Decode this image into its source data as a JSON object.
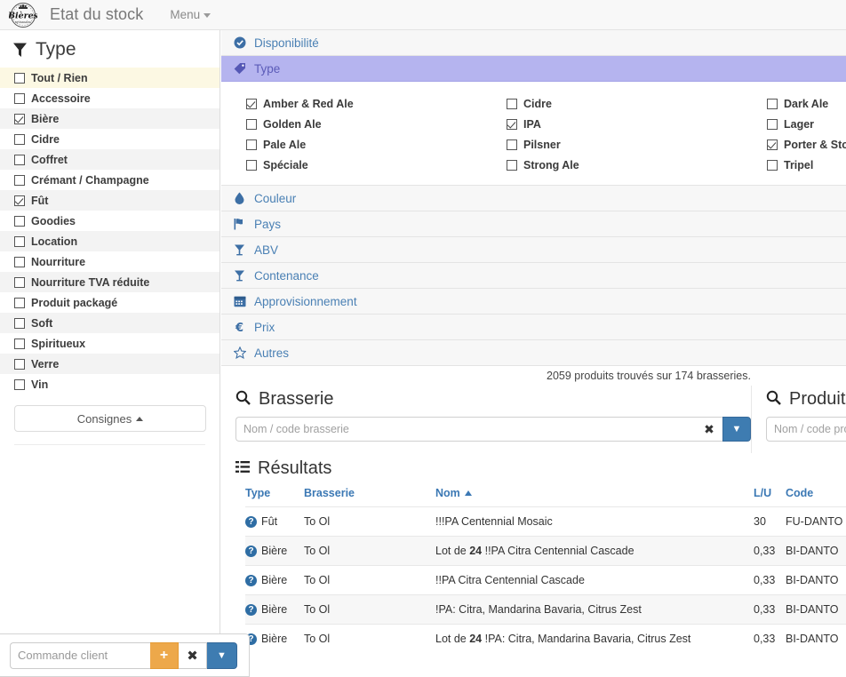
{
  "header": {
    "logo_text": "Bières",
    "title": "Etat du stock",
    "menu_label": "Menu"
  },
  "sidebar": {
    "title": "Type",
    "funnel_icon": "filter-icon",
    "items": [
      {
        "label": "Tout / Rien",
        "checked": false,
        "highlight": true
      },
      {
        "label": "Accessoire",
        "checked": false
      },
      {
        "label": "Bière",
        "checked": true
      },
      {
        "label": "Cidre",
        "checked": false
      },
      {
        "label": "Coffret",
        "checked": false
      },
      {
        "label": "Crémant / Champagne",
        "checked": false
      },
      {
        "label": "Fût",
        "checked": true
      },
      {
        "label": "Goodies",
        "checked": false
      },
      {
        "label": "Location",
        "checked": false
      },
      {
        "label": "Nourriture",
        "checked": false
      },
      {
        "label": "Nourriture TVA réduite",
        "checked": false
      },
      {
        "label": "Produit packagé",
        "checked": false
      },
      {
        "label": "Soft",
        "checked": false
      },
      {
        "label": "Spiritueux",
        "checked": false
      },
      {
        "label": "Verre",
        "checked": false
      },
      {
        "label": "Vin",
        "checked": false
      }
    ],
    "consignes_label": "Consignes"
  },
  "command_bar": {
    "placeholder": "Commande client",
    "value": "",
    "add_label": "+",
    "clear_label": "✖",
    "dropdown_label": "▼"
  },
  "filters": {
    "sections": [
      {
        "label": "Disponibilité",
        "icon": "check-circle-icon",
        "active": false
      },
      {
        "label": "Type",
        "icon": "tag-icon",
        "active": true
      }
    ],
    "type_options": [
      {
        "label": "Amber & Red Ale",
        "checked": true
      },
      {
        "label": "Cidre",
        "checked": false
      },
      {
        "label": "Dark Ale",
        "checked": false
      },
      {
        "label": "Golden Ale",
        "checked": false
      },
      {
        "label": "IPA",
        "checked": true
      },
      {
        "label": "Lager",
        "checked": false
      },
      {
        "label": "Pale Ale",
        "checked": false
      },
      {
        "label": "Pilsner",
        "checked": false
      },
      {
        "label": "Porter & Stout",
        "checked": true
      },
      {
        "label": "Spéciale",
        "checked": false
      },
      {
        "label": "Strong Ale",
        "checked": false
      },
      {
        "label": "Tripel",
        "checked": false
      }
    ],
    "sections_below": [
      {
        "label": "Couleur",
        "icon": "droplet-icon"
      },
      {
        "label": "Pays",
        "icon": "flag-icon"
      },
      {
        "label": "ABV",
        "icon": "cocktail-icon"
      },
      {
        "label": "Contenance",
        "icon": "cocktail-icon"
      },
      {
        "label": "Approvisionnement",
        "icon": "calendar-icon"
      },
      {
        "label": "Prix",
        "icon": "euro-icon"
      },
      {
        "label": "Autres",
        "icon": "star-icon"
      }
    ]
  },
  "count_text": "2059 produits trouvés sur 174 brasseries.",
  "search": {
    "brasserie": {
      "title": "Brasserie",
      "icon": "search-icon",
      "placeholder": "Nom / code brasserie",
      "value": "",
      "clear_label": "✖",
      "dropdown_label": "▼"
    },
    "produit": {
      "title": "Produit",
      "icon": "search-icon",
      "placeholder": "Nom / code produit",
      "value": ""
    }
  },
  "results": {
    "title": "Résultats",
    "icon": "list-icon",
    "columns": [
      "Type",
      "Brasserie",
      "Nom",
      "L/U",
      "Code"
    ],
    "sort_column": "Nom",
    "sort_dir": "asc",
    "rows": [
      {
        "type": "Fût",
        "brasserie": "To Ol",
        "nom_prefix": "",
        "nom_bold": "",
        "nom": "!!!PA Centennial Mosaic",
        "lu": "30",
        "code": "FU-DANTO"
      },
      {
        "type": "Bière",
        "brasserie": "To Ol",
        "nom_prefix": "Lot de ",
        "nom_bold": "24",
        "nom": " !!PA Citra Centennial Cascade",
        "lu": "0,33",
        "code": "BI-DANTO"
      },
      {
        "type": "Bière",
        "brasserie": "To Ol",
        "nom_prefix": "",
        "nom_bold": "",
        "nom": "!!PA Citra Centennial Cascade",
        "lu": "0,33",
        "code": "BI-DANTO"
      },
      {
        "type": "Bière",
        "brasserie": "To Ol",
        "nom_prefix": "",
        "nom_bold": "",
        "nom": "!PA: Citra, Mandarina Bavaria, Citrus Zest",
        "lu": "0,33",
        "code": "BI-DANTO"
      },
      {
        "type": "Bière",
        "brasserie": "To Ol",
        "nom_prefix": "Lot de ",
        "nom_bold": "24",
        "nom": " !PA: Citra, Mandarina Bavaria, Citrus Zest",
        "lu": "0,33",
        "code": "BI-DANTO"
      }
    ]
  }
}
